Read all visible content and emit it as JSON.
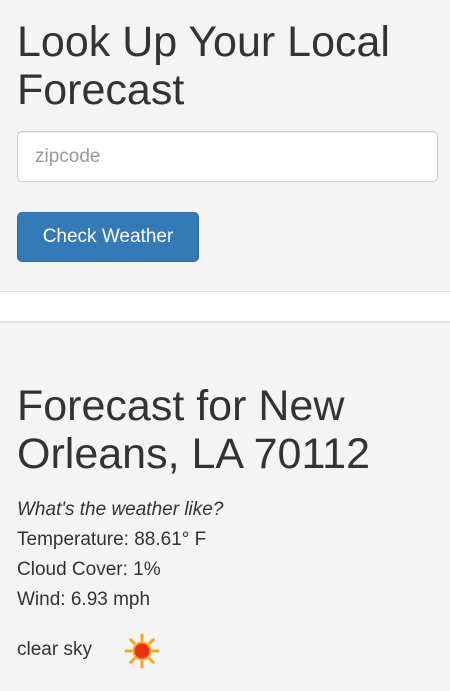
{
  "search": {
    "title": "Look Up Your Local Forecast",
    "zip_placeholder": "zipcode",
    "zip_value": "",
    "button_label": "Check Weather"
  },
  "result": {
    "title": "Forecast for New Orleans, LA 70112",
    "question": "What's the weather like?",
    "temperature": "Temperature: 88.61° F",
    "cloud_cover": "Cloud Cover: 1%",
    "wind": "Wind: 6.93 mph",
    "condition": "clear sky",
    "condition_icon": "sun-icon"
  },
  "colors": {
    "background": "#f4f4f4",
    "primary_button": "#337ab7",
    "text": "#333333",
    "sun_core": "#e8321c",
    "sun_rays": "#f5a623"
  }
}
